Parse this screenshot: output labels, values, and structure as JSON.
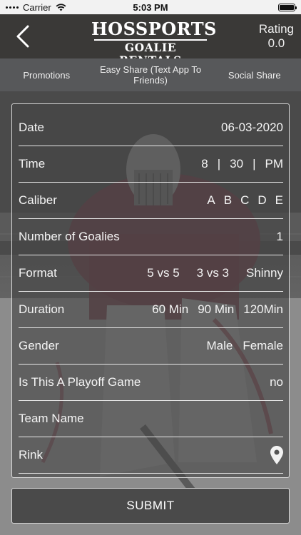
{
  "status_bar": {
    "carrier": "Carrier",
    "time": "5:03 PM"
  },
  "header": {
    "logo_line1": "HOSSPORTS",
    "logo_line2": "GOALIE RENTALS",
    "rating_label": "Rating",
    "rating_value": "0.0"
  },
  "subnav": {
    "promotions": "Promotions",
    "easy_share": "Easy Share (Text App To Friends)",
    "social_share": "Social Share"
  },
  "form": {
    "date": {
      "label": "Date",
      "value": "06-03-2020"
    },
    "time": {
      "label": "Time",
      "hour": "8",
      "minute": "30",
      "ampm": "PM",
      "separator": "|"
    },
    "caliber": {
      "label": "Caliber",
      "options": [
        "A",
        "B",
        "C",
        "D",
        "E"
      ]
    },
    "goalies": {
      "label": "Number of Goalies",
      "value": "1"
    },
    "format": {
      "label": "Format",
      "options": [
        "5 vs 5",
        "3 vs 3",
        "Shinny"
      ]
    },
    "duration": {
      "label": "Duration",
      "options": [
        "60 Min",
        "90 Min",
        "120Min"
      ]
    },
    "gender": {
      "label": "Gender",
      "options": [
        "Male",
        "Female"
      ]
    },
    "playoff": {
      "label": "Is This A Playoff Game",
      "value": "no"
    },
    "team_name": {
      "label": "Team Name"
    },
    "rink": {
      "label": "Rink",
      "icon": "location-pin-icon"
    }
  },
  "submit": {
    "label": "SUBMIT"
  }
}
